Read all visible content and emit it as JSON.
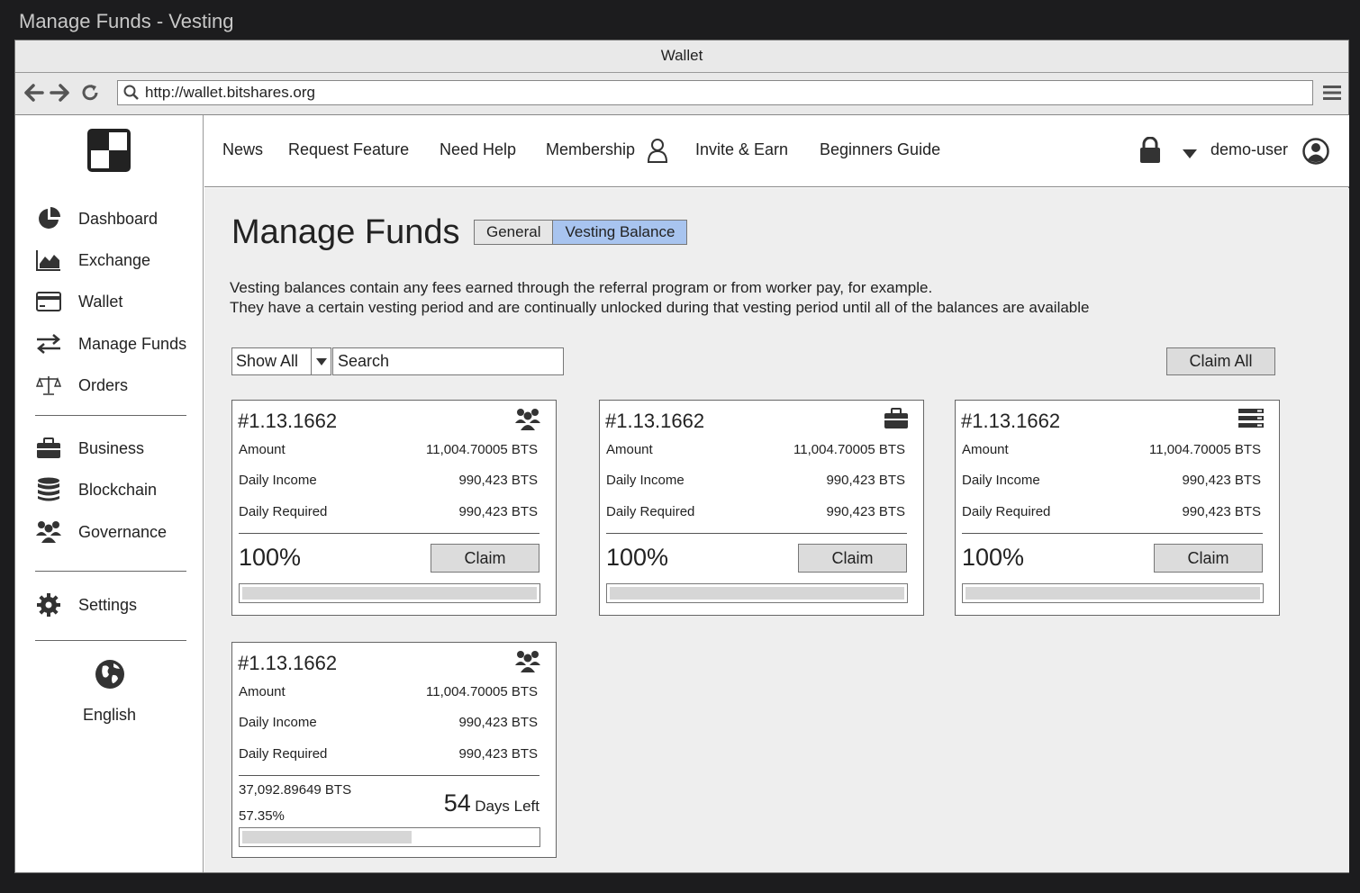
{
  "window": {
    "title": "Manage Funds - Vesting"
  },
  "browser": {
    "tab_title": "Wallet",
    "url": "http://wallet.bitshares.org"
  },
  "sidebar": {
    "items": [
      {
        "label": "Dashboard",
        "icon": "pie-chart-icon"
      },
      {
        "label": "Exchange",
        "icon": "area-chart-icon"
      },
      {
        "label": "Wallet",
        "icon": "credit-card-icon"
      },
      {
        "label": "Manage Funds",
        "icon": "exchange-arrows-icon"
      },
      {
        "label": "Orders",
        "icon": "balance-scale-icon"
      },
      {
        "label": "Business",
        "icon": "briefcase-icon"
      },
      {
        "label": "Blockchain",
        "icon": "database-icon"
      },
      {
        "label": "Governance",
        "icon": "users-icon"
      },
      {
        "label": "Settings",
        "icon": "gear-icon"
      }
    ],
    "language": "English"
  },
  "topnav": {
    "links": [
      "News",
      "Request Feature",
      "Need Help",
      "Membership",
      "Invite & Earn",
      "Beginners Guide"
    ],
    "username": "demo-user"
  },
  "main": {
    "title": "Manage Funds",
    "tabs": [
      "General",
      "Vesting Balance"
    ],
    "active_tab": "Vesting Balance",
    "description_line1": "Vesting balances contain any fees earned through the referral program or from worker pay, for example.",
    "description_line2": "They have a certain vesting period and are continually unlocked during that vesting period until all of the balances are available",
    "filter_value": "Show All",
    "search_placeholder": "Search",
    "claim_all_label": "Claim All"
  },
  "labels": {
    "amount": "Amount",
    "daily_income": "Daily Income",
    "daily_required": "Daily Required",
    "claim": "Claim",
    "days_left": "Days Left"
  },
  "cards": [
    {
      "id": "#1.13.1662",
      "icon": "users-icon",
      "amount": "11,004.70005 BTS",
      "daily_income": "990,423 BTS",
      "daily_required": "990,423 BTS",
      "percent": "100%",
      "progress": 1.0
    },
    {
      "id": "#1.13.1662",
      "icon": "briefcase-icon",
      "amount": "11,004.70005 BTS",
      "daily_income": "990,423 BTS",
      "daily_required": "990,423 BTS",
      "percent": "100%",
      "progress": 1.0
    },
    {
      "id": "#1.13.1662",
      "icon": "server-icon",
      "amount": "11,004.70005 BTS",
      "daily_income": "990,423 BTS",
      "daily_required": "990,423 BTS",
      "percent": "100%",
      "progress": 1.0
    },
    {
      "id": "#1.13.1662",
      "icon": "users-icon",
      "amount": "11,004.70005 BTS",
      "daily_income": "990,423 BTS",
      "daily_required": "990,423 BTS",
      "vested": "37,092.89649 BTS",
      "percent": "57.35%",
      "days": "54",
      "progress": 0.5735
    }
  ]
}
